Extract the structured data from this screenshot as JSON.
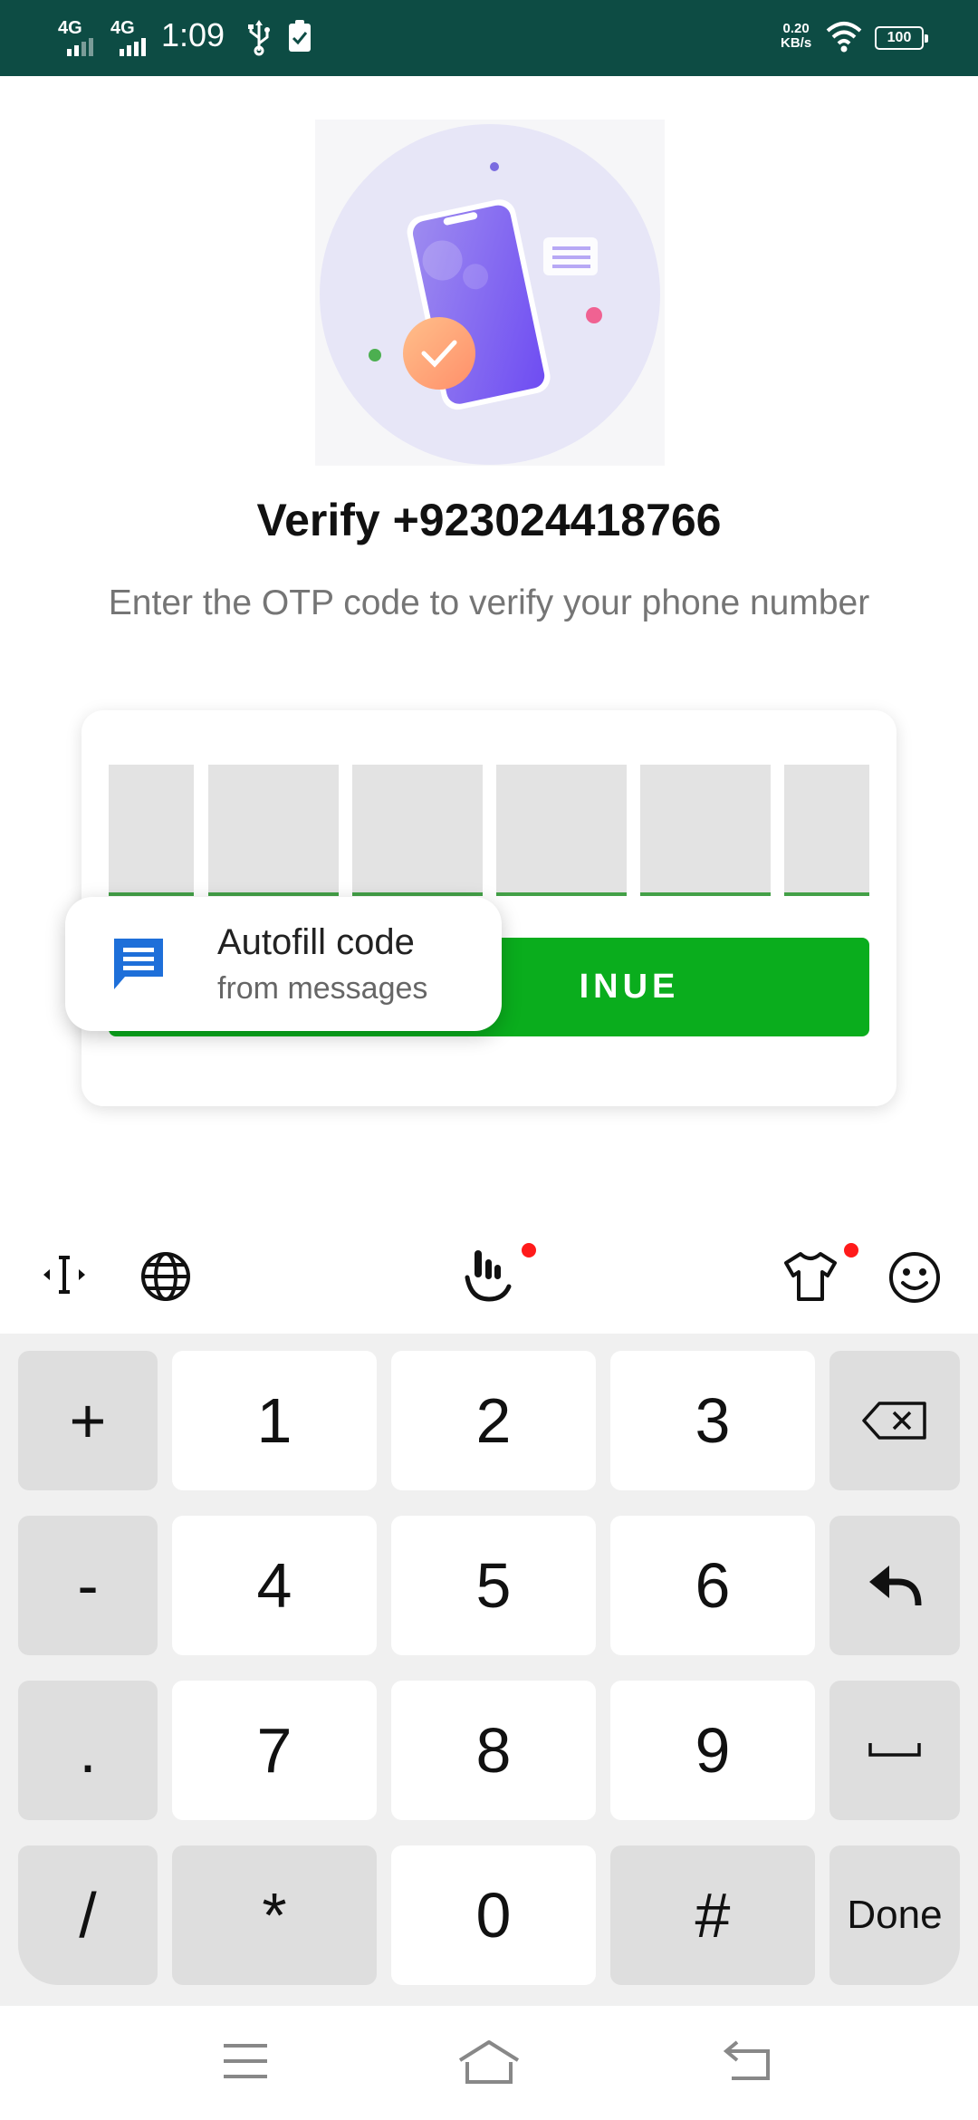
{
  "status_bar": {
    "signal1": "4G",
    "signal2": "4G",
    "time": "1:09",
    "speed_value": "0.20",
    "speed_unit": "KB/s",
    "battery": "100"
  },
  "verify": {
    "title": "Verify +923024418766",
    "subtitle": "Enter the OTP code to verify your phone number"
  },
  "otp": {
    "continue_label": "CONTINUE",
    "continue_visible_label": "INUE"
  },
  "autofill": {
    "title": "Autofill code",
    "subtitle": "from messages"
  },
  "keyboard": {
    "toolbar": [
      "cursor-icon",
      "globe-icon",
      "gesture-icon",
      "theme-shirt-icon",
      "emoji-icon"
    ],
    "keys": {
      "plus": "+",
      "one": "1",
      "two": "2",
      "three": "3",
      "minus": "-",
      "four": "4",
      "five": "5",
      "six": "6",
      "dot": ".",
      "seven": "7",
      "eight": "8",
      "nine": "9",
      "slash": "/",
      "star": "*",
      "zero": "0",
      "hash": "#",
      "done": "Done"
    }
  },
  "colors": {
    "status_bar": "#0d4c44",
    "accent_green": "#0aad1d",
    "otp_underline": "#43a047",
    "notification_dot": "#ff1a1a"
  }
}
